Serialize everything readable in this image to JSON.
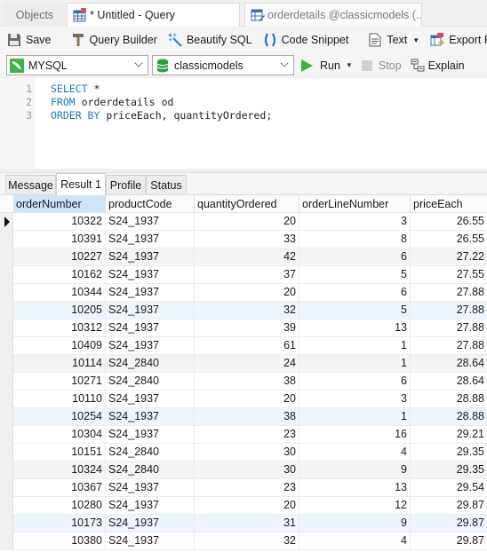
{
  "tabs": {
    "objects": "Objects",
    "query": "* Untitled - Query",
    "table": "orderdetails @classicmodels (..."
  },
  "toolbar": {
    "save": "Save",
    "query_builder": "Query Builder",
    "beautify": "Beautify SQL",
    "code_snippet": "Code Snippet",
    "text": "Text",
    "export": "Export Result"
  },
  "toolbar2": {
    "connection": "MYSQL",
    "database": "classicmodels",
    "run": "Run",
    "stop": "Stop",
    "explain": "Explain"
  },
  "editor": {
    "lines": [
      {
        "num": "1",
        "kw": "SELECT",
        "rest": " *"
      },
      {
        "num": "2",
        "kw": "FROM",
        "rest": " orderdetails od"
      },
      {
        "num": "3",
        "kw": "ORDER BY",
        "rest": " priceEach, quantityOrdered;"
      }
    ]
  },
  "result_tabs": [
    "Message",
    "Result 1",
    "Profile",
    "Status"
  ],
  "grid": {
    "columns": [
      "orderNumber",
      "productCode",
      "quantityOrdered",
      "orderLineNumber",
      "priceEach"
    ],
    "rows": [
      [
        "10322",
        "S24_1937",
        "20",
        "3",
        "26.55"
      ],
      [
        "10391",
        "S24_1937",
        "33",
        "8",
        "26.55"
      ],
      [
        "10227",
        "S24_1937",
        "42",
        "6",
        "27.22"
      ],
      [
        "10162",
        "S24_1937",
        "37",
        "5",
        "27.55"
      ],
      [
        "10344",
        "S24_1937",
        "20",
        "6",
        "27.88"
      ],
      [
        "10205",
        "S24_1937",
        "32",
        "5",
        "27.88"
      ],
      [
        "10312",
        "S24_1937",
        "39",
        "13",
        "27.88"
      ],
      [
        "10409",
        "S24_1937",
        "61",
        "1",
        "27.88"
      ],
      [
        "10114",
        "S24_2840",
        "24",
        "1",
        "28.64"
      ],
      [
        "10271",
        "S24_2840",
        "38",
        "6",
        "28.64"
      ],
      [
        "10110",
        "S24_1937",
        "20",
        "3",
        "28.88"
      ],
      [
        "10254",
        "S24_1937",
        "38",
        "1",
        "28.88"
      ],
      [
        "10304",
        "S24_1937",
        "23",
        "16",
        "29.21"
      ],
      [
        "10151",
        "S24_2840",
        "30",
        "4",
        "29.35"
      ],
      [
        "10324",
        "S24_2840",
        "30",
        "9",
        "29.35"
      ],
      [
        "10367",
        "S24_1937",
        "23",
        "13",
        "29.54"
      ],
      [
        "10280",
        "S24_1937",
        "20",
        "12",
        "29.87"
      ],
      [
        "10173",
        "S24_1937",
        "31",
        "9",
        "29.87"
      ],
      [
        "10380",
        "S24_1937",
        "32",
        "4",
        "29.87"
      ]
    ]
  }
}
